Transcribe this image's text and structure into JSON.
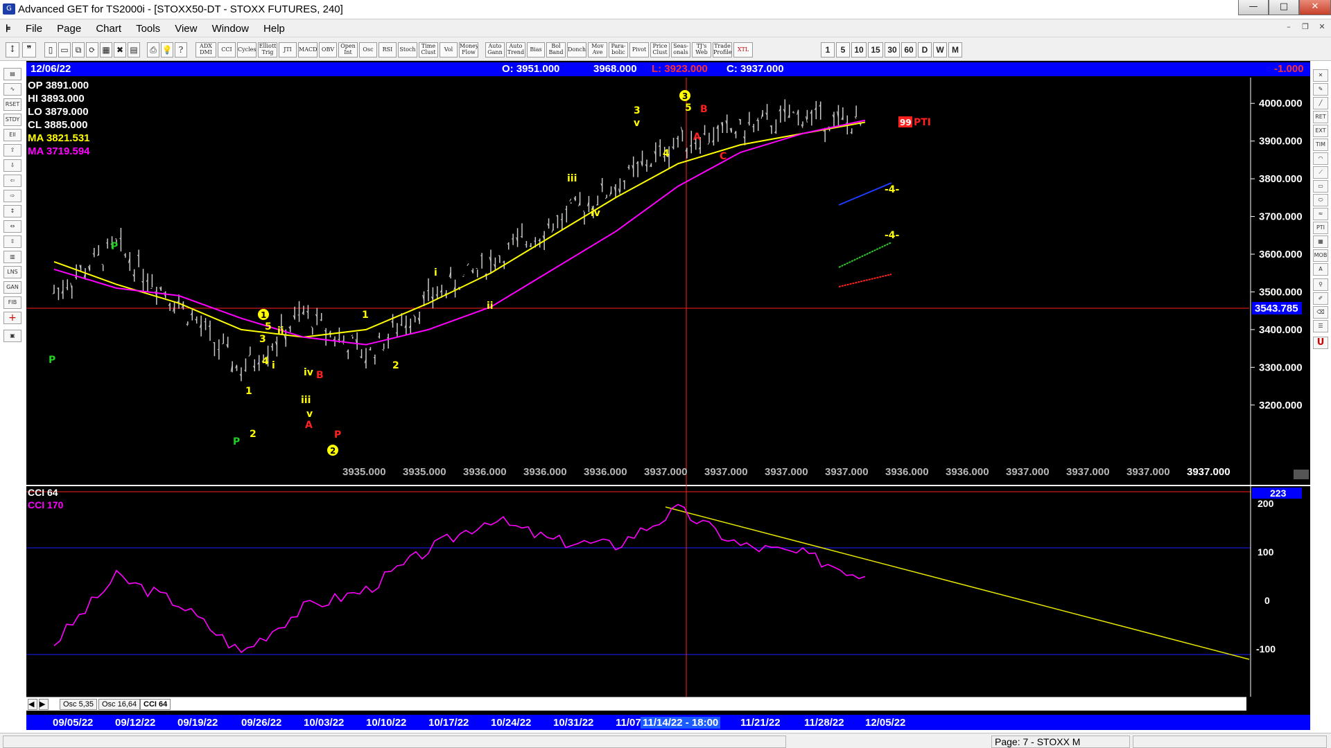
{
  "window": {
    "title": "Advanced GET for TS2000i - [STOXX50-DT - STOXX FUTURES, 240]",
    "min_glyph": "—",
    "max_glyph": "□",
    "close_glyph": "✕"
  },
  "menu": [
    "File",
    "Page",
    "Chart",
    "Tools",
    "View",
    "Window",
    "Help"
  ],
  "toolbar": {
    "studies": [
      "ADX DMI",
      "CCI",
      "Cycles",
      "Elliott Trig",
      "JTI",
      "MACD",
      "OBV",
      "Open Int",
      "Osc",
      "RSI",
      "Stoch",
      "Time Clust",
      "Vol",
      "Money Flow",
      "Auto Gann",
      "Auto Trend",
      "Bias",
      "Bol Band",
      "Donch",
      "Mov Ave",
      "Para-bolic",
      "Pivot",
      "Price Clust",
      "Seas-onals",
      "TJ's Web",
      "Trade Profile",
      "XTL"
    ],
    "intervals": [
      "1",
      "5",
      "10",
      "15",
      "30",
      "60",
      "D",
      "W",
      "M"
    ]
  },
  "infobar": {
    "date": "12/06/22",
    "open": "O: 3951.000",
    "high": "3968.000",
    "low": "L: 3923.000",
    "close": "C: 3937.000",
    "change": "-1.000"
  },
  "stats": {
    "op": "OP 3891.000",
    "hi": "HI   3893.000",
    "lo": "LO  3879.000",
    "cl": "CL  3885.000",
    "ma1": "MA  3821.531",
    "ma2": "MA  3719.594"
  },
  "price_axis": {
    "ticks": [
      "4000.000",
      "3900.000",
      "3800.000",
      "3700.000",
      "3600.000",
      "3500.000",
      "3400.000",
      "3300.000",
      "3200.000"
    ],
    "marker": "3543.785"
  },
  "bottom_values": [
    "3935.000",
    "3935.000",
    "3936.000",
    "3936.000",
    "3936.000",
    "3937.000",
    "3937.000",
    "3937.000",
    "3937.000",
    "3936.000",
    "3936.000",
    "3937.000",
    "3937.000",
    "3937.000",
    "3937.000"
  ],
  "pti": {
    "value": "99",
    "label": "PTI"
  },
  "labels": {
    "four_label": "-4-",
    "wave3_circle": "3",
    "wave1_circle": "1",
    "wave2_circle": "2"
  },
  "cci": {
    "title1": "CCI 64",
    "title2": "CCI  170",
    "current": "223",
    "ticks": [
      "200",
      "100",
      "0",
      "-100"
    ]
  },
  "tabs": [
    "Osc 5,35",
    "Osc 16,64",
    "CCI 64"
  ],
  "dates": [
    "09/05/22",
    "09/12/22",
    "09/19/22",
    "09/26/22",
    "10/03/22",
    "10/10/22",
    "10/17/22",
    "10/24/22",
    "10/31/22",
    "11/07",
    "11/14/22 - 18:00",
    "11/21/22",
    "11/28/22",
    "12/05/22"
  ],
  "status": {
    "page": "Page: 7 - STOXX M"
  },
  "chart_data": {
    "type": "candlestick",
    "title": "STOXX50-DT - STOXX FUTURES, 240",
    "ylim": [
      3150,
      4050
    ],
    "x": [
      "09/05/22",
      "09/12/22",
      "09/19/22",
      "09/26/22",
      "10/03/22",
      "10/10/22",
      "10/17/22",
      "10/24/22",
      "10/31/22",
      "11/07",
      "11/14/22",
      "11/21/22",
      "11/28/22",
      "12/05/22"
    ],
    "close_approx": [
      3500,
      3620,
      3470,
      3290,
      3440,
      3330,
      3480,
      3580,
      3680,
      3780,
      3900,
      3930,
      3970,
      3937
    ],
    "series": [
      {
        "name": "MA",
        "color": "#ffff00",
        "values": [
          3580,
          3520,
          3470,
          3400,
          3380,
          3400,
          3470,
          3550,
          3650,
          3750,
          3840,
          3890,
          3920,
          3950
        ]
      },
      {
        "name": "MA",
        "color": "#ff00ff",
        "values": [
          3560,
          3510,
          3490,
          3430,
          3380,
          3360,
          3400,
          3460,
          3560,
          3660,
          3780,
          3870,
          3920,
          3955
        ]
      }
    ],
    "cci": {
      "ylim": [
        -220,
        230
      ],
      "values": [
        -110,
        40,
        -20,
        -130,
        -30,
        10,
        100,
        170,
        120,
        110,
        190,
        110,
        90,
        40
      ]
    }
  },
  "colors": {
    "background": "#000000",
    "bar": "#c0c0c0",
    "ma_fast": "#ffff00",
    "ma_slow": "#ff00ff",
    "bar_blue": "#0000ff",
    "hline": "#ff2020"
  }
}
